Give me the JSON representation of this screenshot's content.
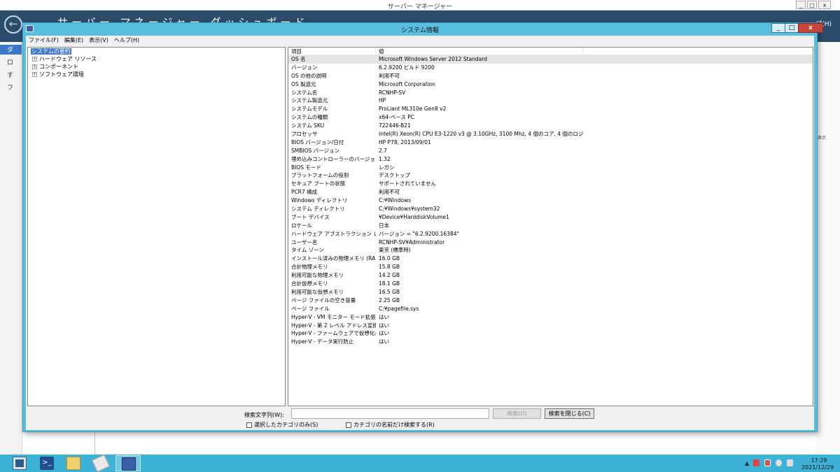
{
  "server_manager": {
    "title": "サーバー マネージャー",
    "heading": "サーバー マネージャー ダッシュボード",
    "help_partial": "プ(H)",
    "sidebar": [
      "ダ",
      "ロ",
      "す",
      "フ"
    ],
    "right_panel_text": "表示"
  },
  "window": {
    "title": "システム情報",
    "minimize": "_",
    "maximize": "□",
    "close": "x"
  },
  "menu": [
    "ファイル(F)",
    "編集(E)",
    "表示(V)",
    "ヘルプ(H)"
  ],
  "tree": [
    {
      "label": "システムの要約",
      "selected": true,
      "expander": ""
    },
    {
      "label": "ハードウェア リソース",
      "selected": false,
      "expander": "+"
    },
    {
      "label": "コンポーネント",
      "selected": false,
      "expander": "+"
    },
    {
      "label": "ソフトウェア環境",
      "selected": false,
      "expander": "+"
    }
  ],
  "details": {
    "columns": [
      "項目",
      "値"
    ],
    "rows": [
      [
        "OS 名",
        "Microsoft Windows Server 2012 Standard"
      ],
      [
        "バージョン",
        "6.2.9200 ビルド 9200"
      ],
      [
        "OS の他の説明",
        "利用不可"
      ],
      [
        "OS 製造元",
        "Microsoft Corporation"
      ],
      [
        "システム名",
        "RCNHP-SV"
      ],
      [
        "システム製造元",
        "HP"
      ],
      [
        "システムモデル",
        "ProLiant ML310e Gen8 v2"
      ],
      [
        "システムの種類",
        "x64-ベース PC"
      ],
      [
        "システム SKU",
        "722446-B21"
      ],
      [
        "プロセッサ",
        "Intel(R) Xeon(R) CPU E3-1220 v3 @ 3.10GHz, 3100 Mhz, 4 個のコア, 4 個のロジ..."
      ],
      [
        "BIOS バージョン/日付",
        "HP P78, 2013/09/01"
      ],
      [
        "SMBIOS バージョン",
        "2.7"
      ],
      [
        "埋め込みコントローラーのバージョン",
        "1.32"
      ],
      [
        "BIOS モード",
        "レガシ"
      ],
      [
        "プラットフォームの役割",
        "デスクトップ"
      ],
      [
        "セキュア ブートの状態",
        "サポートされていません"
      ],
      [
        "PCR7 構成",
        "利用不可"
      ],
      [
        "Windows ディレクトリ",
        "C:¥Windows"
      ],
      [
        "システム ディレクトリ",
        "C:¥Windows¥system32"
      ],
      [
        "ブート デバイス",
        "¥Device¥HarddiskVolume1"
      ],
      [
        "ロケール",
        "日本"
      ],
      [
        "ハードウェア アブストラクション レイヤー",
        "バージョン = \"6.2.9200.16384\""
      ],
      [
        "ユーザー名",
        "RCNHP-SV¥Administrator"
      ],
      [
        "タイム ゾーン",
        "東京 (標準時)"
      ],
      [
        "インストール済みの物理メモリ (RAM)",
        "16.0 GB"
      ],
      [
        "合計物理メモリ",
        "15.8 GB"
      ],
      [
        "利用可能な物理メモリ",
        "14.2 GB"
      ],
      [
        "合計仮想メモリ",
        "18.1 GB"
      ],
      [
        "利用可能な仮想メモリ",
        "16.5 GB"
      ],
      [
        "ページ ファイルの空き容量",
        "2.25 GB"
      ],
      [
        "ページ ファイル",
        "C:¥pagefile.sys"
      ],
      [
        "Hyper-V - VM モニター モード拡張...",
        "はい"
      ],
      [
        "Hyper-V - 第 2 レベル アドレス変換...",
        "はい"
      ],
      [
        "Hyper-V - ファームウェアで仮想化が...",
        "はい"
      ],
      [
        "Hyper-V - データ実行防止",
        "はい"
      ]
    ]
  },
  "search": {
    "label": "検索文字列(W):",
    "value": "",
    "search_button": "検索(D)",
    "close_button": "検索を閉じる(C)",
    "option_selected_category": "選択したカテゴリのみ(S)",
    "option_category_names": "カテゴリの名前だけ検索する(R)"
  },
  "taskbar": {
    "apps": [
      "server-manager-icon",
      "powershell-icon",
      "file-explorer-icon",
      "tools-icon",
      "system-information-icon"
    ],
    "tray_arrow": "▲",
    "time": "17:29",
    "date": "2021/12/29"
  },
  "colors": {
    "window_frame": "#58bede",
    "taskbar": "#3eb2d6",
    "selection": "#3c78c8",
    "close_button": "#c7463c",
    "sm_header": "#2c4c6b"
  }
}
